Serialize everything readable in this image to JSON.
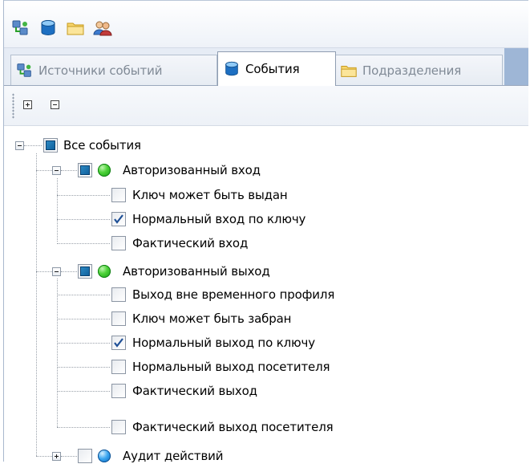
{
  "toolbar": {
    "buttons": [
      {
        "icon": "event-sources-icon"
      },
      {
        "icon": "events-db-icon"
      },
      {
        "icon": "folder-icon"
      },
      {
        "icon": "users-icon"
      }
    ]
  },
  "tabs": [
    {
      "label": "Источники событий",
      "icon": "event-sources-icon",
      "active": false
    },
    {
      "label": "События",
      "icon": "events-db-icon",
      "active": true
    },
    {
      "label": "Подразделения",
      "icon": "folder-icon",
      "active": false
    }
  ],
  "subtoolbar": {
    "expand_all_icon": "plus-box-icon",
    "collapse_all_icon": "minus-box-icon"
  },
  "tree": {
    "root": {
      "label": "Все события",
      "state": "partial",
      "expanded": true
    },
    "groups": [
      {
        "label": "Авторизованный вход",
        "state": "partial",
        "status": "green",
        "expanded": true,
        "items": [
          {
            "label": "Ключ может быть выдан",
            "checked": false
          },
          {
            "label": "Нормальный вход по ключу",
            "checked": true
          },
          {
            "label": "Фактический вход",
            "checked": false
          }
        ]
      },
      {
        "label": "Авторизованный выход",
        "state": "partial",
        "status": "green",
        "expanded": true,
        "items": [
          {
            "label": "Выход вне временного профиля",
            "checked": false
          },
          {
            "label": "Ключ может быть забран",
            "checked": false
          },
          {
            "label": "Нормальный выход по ключу",
            "checked": true
          },
          {
            "label": "Нормальный выход посетителя",
            "checked": false
          },
          {
            "label": "Фактический выход",
            "checked": false
          },
          {
            "label": "Фактический выход посетителя",
            "checked": false
          }
        ]
      },
      {
        "label": "Аудит действий",
        "state": "unchecked",
        "status": "blue",
        "expanded": false,
        "items": []
      }
    ]
  },
  "colors": {
    "accent_blue": "#0d5d9a",
    "status_green": "#4fd33a",
    "status_blue": "#3aa6f0",
    "tab_strip": "#e6ecf5"
  }
}
